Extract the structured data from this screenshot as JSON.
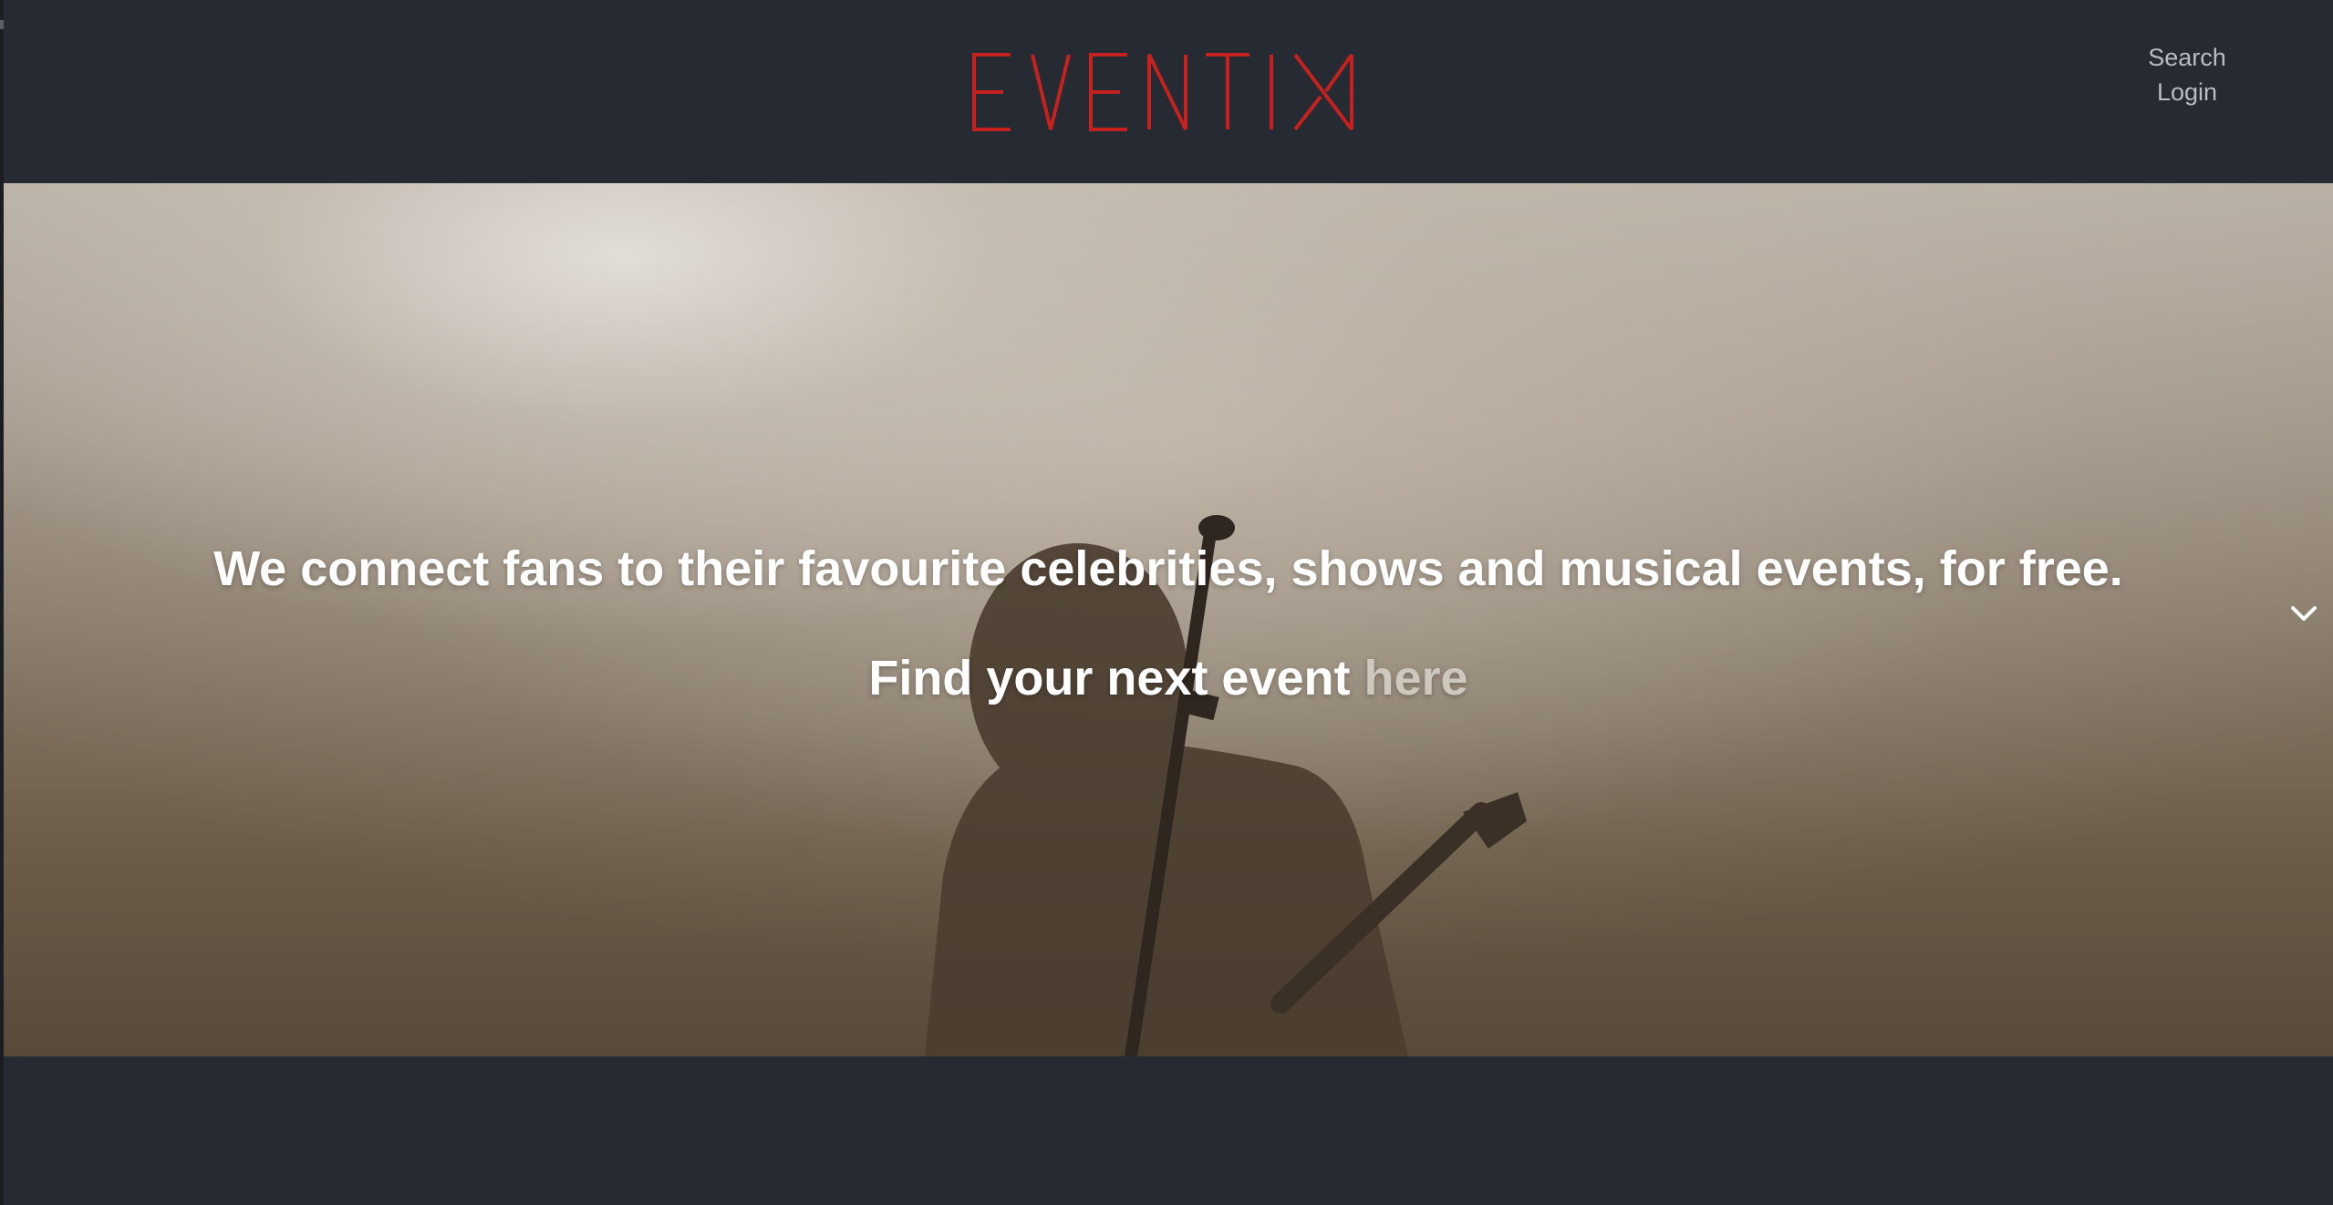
{
  "header": {
    "logo_text": "EVENTIX",
    "brand_color": "#c5221f",
    "nav": {
      "search_label": "Search",
      "login_label": "Login"
    }
  },
  "hero": {
    "tagline": "We connect fans to their favourite celebrities, shows and musical events, for free.",
    "cta_prefix": "Find your next event ",
    "cta_link": "here",
    "scroll_icon": "chevron-down-icon"
  },
  "colors": {
    "background": "#262a32",
    "nav_text": "#b9bcc2",
    "link_muted": "#cfc8bf"
  }
}
